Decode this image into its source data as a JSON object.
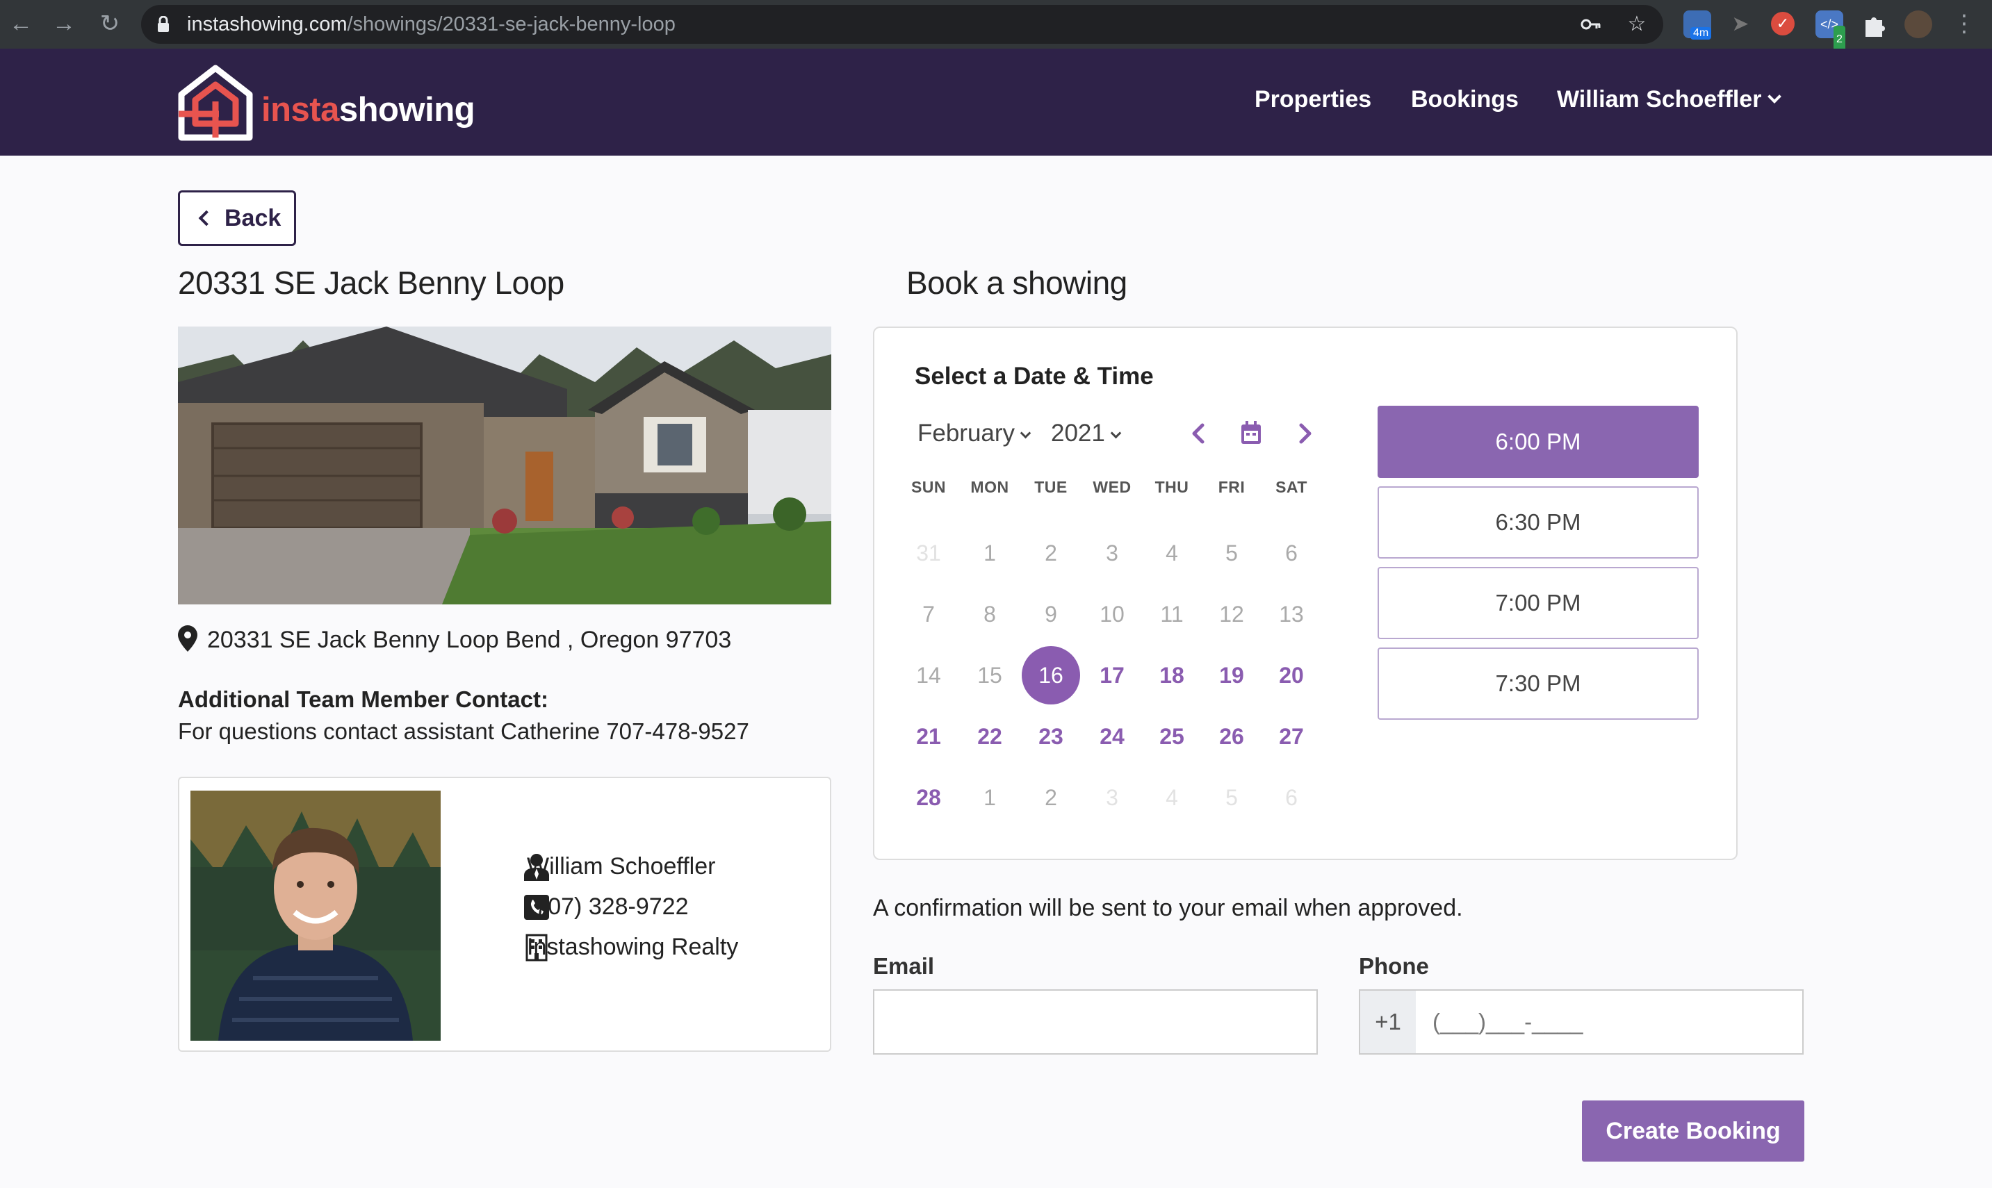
{
  "browser": {
    "url_host": "instashowing.com",
    "url_path": "/showings/20331-se-jack-benny-loop",
    "ext_badge_1": "4m",
    "ext_badge_2": "2"
  },
  "header": {
    "logo_part1": "insta",
    "logo_part2": "showing",
    "nav": [
      "Properties",
      "Bookings",
      "William Schoeffler"
    ]
  },
  "back_label": "Back",
  "property": {
    "title": "20331 SE Jack Benny Loop",
    "address": "20331 SE Jack Benny Loop Bend , Oregon 97703",
    "contact_heading": "Additional Team Member Contact:",
    "contact_text": "For questions contact assistant Catherine 707-478-9527"
  },
  "agent": {
    "name": "William Schoeffler",
    "phone": "(707) 328-9722",
    "company": "Instashowing Realty"
  },
  "booking": {
    "heading": "Book a showing",
    "card_title": "Select a Date & Time",
    "month": "February",
    "year": "2021",
    "weekdays": [
      "SUN",
      "MON",
      "TUE",
      "WED",
      "THU",
      "FRI",
      "SAT"
    ],
    "weeks": [
      [
        {
          "d": "31",
          "s": "faint"
        },
        {
          "d": "1",
          "s": "muted"
        },
        {
          "d": "2",
          "s": "muted"
        },
        {
          "d": "3",
          "s": "muted"
        },
        {
          "d": "4",
          "s": "muted"
        },
        {
          "d": "5",
          "s": "muted"
        },
        {
          "d": "6",
          "s": "muted"
        }
      ],
      [
        {
          "d": "7",
          "s": "muted"
        },
        {
          "d": "8",
          "s": "muted"
        },
        {
          "d": "9",
          "s": "muted"
        },
        {
          "d": "10",
          "s": "muted"
        },
        {
          "d": "11",
          "s": "muted"
        },
        {
          "d": "12",
          "s": "muted"
        },
        {
          "d": "13",
          "s": "muted"
        }
      ],
      [
        {
          "d": "14",
          "s": "muted"
        },
        {
          "d": "15",
          "s": "muted"
        },
        {
          "d": "16",
          "s": "selected"
        },
        {
          "d": "17",
          "s": "avail"
        },
        {
          "d": "18",
          "s": "avail"
        },
        {
          "d": "19",
          "s": "avail"
        },
        {
          "d": "20",
          "s": "avail"
        }
      ],
      [
        {
          "d": "21",
          "s": "avail"
        },
        {
          "d": "22",
          "s": "avail"
        },
        {
          "d": "23",
          "s": "avail"
        },
        {
          "d": "24",
          "s": "avail"
        },
        {
          "d": "25",
          "s": "avail"
        },
        {
          "d": "26",
          "s": "avail"
        },
        {
          "d": "27",
          "s": "avail"
        }
      ],
      [
        {
          "d": "28",
          "s": "avail"
        },
        {
          "d": "1",
          "s": "muted"
        },
        {
          "d": "2",
          "s": "muted"
        },
        {
          "d": "3",
          "s": "faint"
        },
        {
          "d": "4",
          "s": "faint"
        },
        {
          "d": "5",
          "s": "faint"
        },
        {
          "d": "6",
          "s": "faint"
        }
      ]
    ],
    "times": [
      "6:00 PM",
      "6:30 PM",
      "7:00 PM",
      "7:30 PM"
    ],
    "selected_time": "6:00 PM",
    "confirmation_note": "A confirmation will be sent to your email when approved.",
    "email_label": "Email",
    "email_value": "",
    "phone_label": "Phone",
    "phone_prefix": "+1",
    "phone_placeholder": "(___)___-____",
    "submit_label": "Create Booking"
  },
  "colors": {
    "header_bg": "#2e2248",
    "accent": "#8a5cb0",
    "logo_red": "#e8544f"
  },
  "icons": [
    "back-arrow-icon",
    "reload-icon",
    "lock-icon",
    "key-icon",
    "star-icon",
    "puzzle-icon",
    "map-pin-icon",
    "user-icon",
    "phone-icon",
    "building-icon",
    "calendar-icon",
    "chevron-left-icon",
    "chevron-right-icon"
  ]
}
